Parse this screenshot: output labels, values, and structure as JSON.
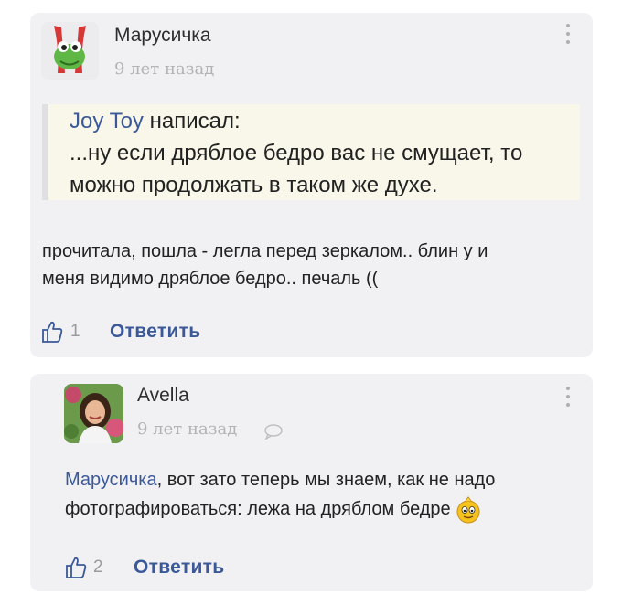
{
  "comments": [
    {
      "author": "Марусичка",
      "time": "9 лет назад",
      "quote": {
        "author": "Joy Toy",
        "verb": "написал:",
        "line1": "...ну если дряблое бедро вас не смущает, то",
        "line2": "можно продолжать в таком же духе."
      },
      "text_line1": "прочитала, пошла - легла перед зеркалом.. блин у и",
      "text_line2": "меня видимо дряблое бедро.. печаль ((",
      "likes": "1",
      "reply_label": "Ответить"
    },
    {
      "author": "Avella",
      "time": "9 лет назад",
      "mention": "Марусичка",
      "text_line1_rest": ", вот зато теперь мы знаем, как не надо",
      "text_line2": "фотографироваться:  лежа на дряблом бедре",
      "likes": "2",
      "reply_label": "Ответить"
    }
  ],
  "colors": {
    "accent": "#3b5998",
    "card_bg": "#f1f1f3",
    "quote_bg": "#f8f7ea"
  }
}
